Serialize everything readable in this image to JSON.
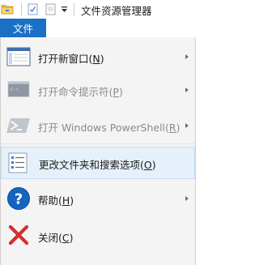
{
  "window": {
    "title": "文件资源管理器"
  },
  "quick_access": {
    "icons": [
      "folder-icon",
      "properties-icon",
      "new-folder-icon",
      "customize-dropdown-icon"
    ]
  },
  "ribbon": {
    "file_tab_label": "文件"
  },
  "file_menu": {
    "items": [
      {
        "label": "打开新窗口(",
        "key": "N",
        "suffix": ")",
        "icon": "new-window-icon",
        "enabled": true,
        "submenu": true
      },
      {
        "label": "打开命令提示符(",
        "key": "P",
        "suffix": ")",
        "icon": "command-prompt-icon",
        "enabled": false,
        "submenu": true
      },
      {
        "label": "打开 Windows PowerShell(",
        "key": "R",
        "suffix": ")",
        "icon": "powershell-icon",
        "enabled": false,
        "submenu": true
      },
      {
        "label": "更改文件夹和搜索选项(",
        "key": "O",
        "suffix": ")",
        "icon": "folder-options-icon",
        "enabled": true,
        "submenu": false,
        "highlighted": true
      },
      {
        "label": "帮助(",
        "key": "H",
        "suffix": ")",
        "icon": "help-icon",
        "enabled": true,
        "submenu": true
      },
      {
        "label": "关闭(",
        "key": "C",
        "suffix": ")",
        "icon": "close-icon",
        "enabled": true,
        "submenu": false
      }
    ]
  },
  "colors": {
    "file_tab_bg": "#1a6fc6",
    "menu_bg": "#f4f4f4",
    "highlight_bg": "#e6f0fa",
    "highlight_border": "#c5ddf5",
    "help_blue": "#1565c0",
    "close_red": "#d32f2f"
  }
}
